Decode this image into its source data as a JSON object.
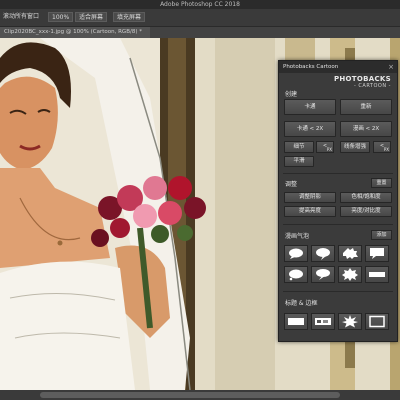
{
  "window": {
    "title": "Adobe Photoshop CC 2018"
  },
  "options_bar": {
    "item1": "滚动所有窗口",
    "zoom": "100%",
    "fit_screen": "适合屏幕",
    "fill_screen": "填充屏幕"
  },
  "document_tab": {
    "label": "Clip2020BC_xxx-1.jpg @ 100% (Cartoon, RGB/8) *"
  },
  "panel": {
    "title": "Photobacks Cartoon",
    "close_glyph": "×",
    "logo_line1": "PHOTOBACKS",
    "logo_line2": "- CARTOON -",
    "section1": {
      "title": "创建",
      "btn_cartoon": "卡通",
      "btn_redo": "重新",
      "btn_cartoon_2x": "卡通 < 2X",
      "btn_redo_2x": "漫画 < 2X",
      "btn_detail": "细节",
      "btn_px1": "<",
      "btn_px1_sub": "PX",
      "btn_enhance": "线条增强",
      "btn_px2": "<",
      "btn_px2_sub": "PX",
      "btn_flatten": "平滑"
    },
    "section2": {
      "title": "调整",
      "reset": "重置",
      "btn_color_shadow": "调整阴影",
      "btn_saturation": "色相/饱和度",
      "btn_levels": "提高亮度",
      "btn_contrast": "亮度/对比度"
    },
    "section3": {
      "title": "漫画气泡",
      "add": "添加",
      "icons": [
        "speech-bubble-round",
        "speech-bubble-round-tail",
        "burst-bubble",
        "speech-bubble-square",
        "thought-bubble",
        "speech-bubble-tail-down",
        "spiky-bubble",
        "caption-bar"
      ]
    },
    "section4": {
      "title": "标题 & 边框",
      "icons": [
        "white-box",
        "pattern-box",
        "star-burst",
        "frame-border"
      ]
    }
  },
  "colors": {
    "panel_bg": "#3b3b3b",
    "button": "#515151",
    "canvas_bg": "#e9e4d4"
  }
}
